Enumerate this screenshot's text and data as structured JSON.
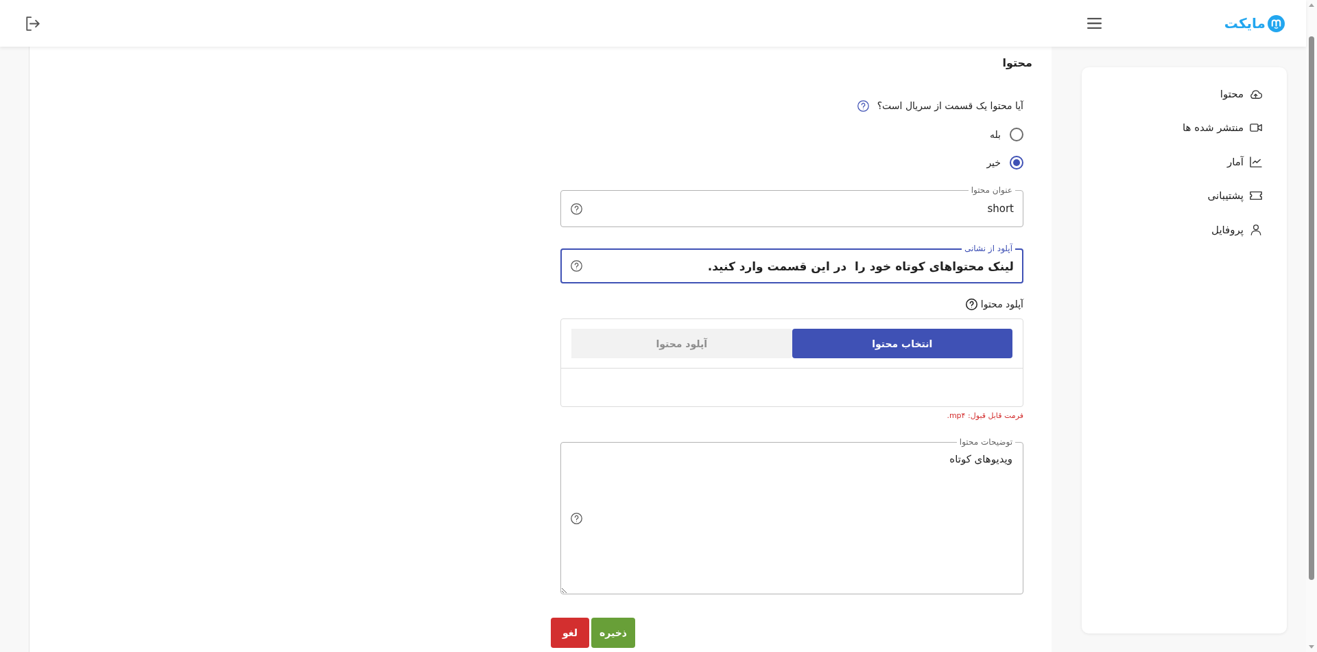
{
  "header": {
    "logo": "مایکت"
  },
  "sidebar": {
    "items": [
      {
        "label": "محتوا"
      },
      {
        "label": "منتشر شده ها"
      },
      {
        "label": "آمار"
      },
      {
        "label": "پشتیبانی"
      },
      {
        "label": "پروفایل"
      }
    ]
  },
  "content": {
    "title": "محتوا",
    "series_question": {
      "label": "آیا محتوا یک قسمت از سریال است؟",
      "options": [
        {
          "label": "بله",
          "selected": false
        },
        {
          "label": "خیر",
          "selected": true
        }
      ]
    },
    "title_field": {
      "label": "عنوان محتوا",
      "value": "short",
      "focused": false
    },
    "url_field": {
      "label": "آپلود از نشانی",
      "placeholder": "لینک محتواهای کوتاه خود را  در این قسمت وارد کنید.",
      "focused": true
    },
    "upload": {
      "label": "آپلود محتوا",
      "buttons": [
        {
          "label": "انتخاب محتوا",
          "disabled": false
        },
        {
          "label": "آپلود محتوا",
          "disabled": true
        }
      ],
      "hint": "فرمت قابل قبول: mp۴."
    },
    "description_field": {
      "label": "توضیحات محتوا",
      "value": "ویدیوهای کوتاه",
      "focused": false
    },
    "actions": [
      {
        "label": "ذخیره",
        "color": "#689f38"
      },
      {
        "label": "لغو",
        "color": "#d32f2f"
      }
    ]
  }
}
